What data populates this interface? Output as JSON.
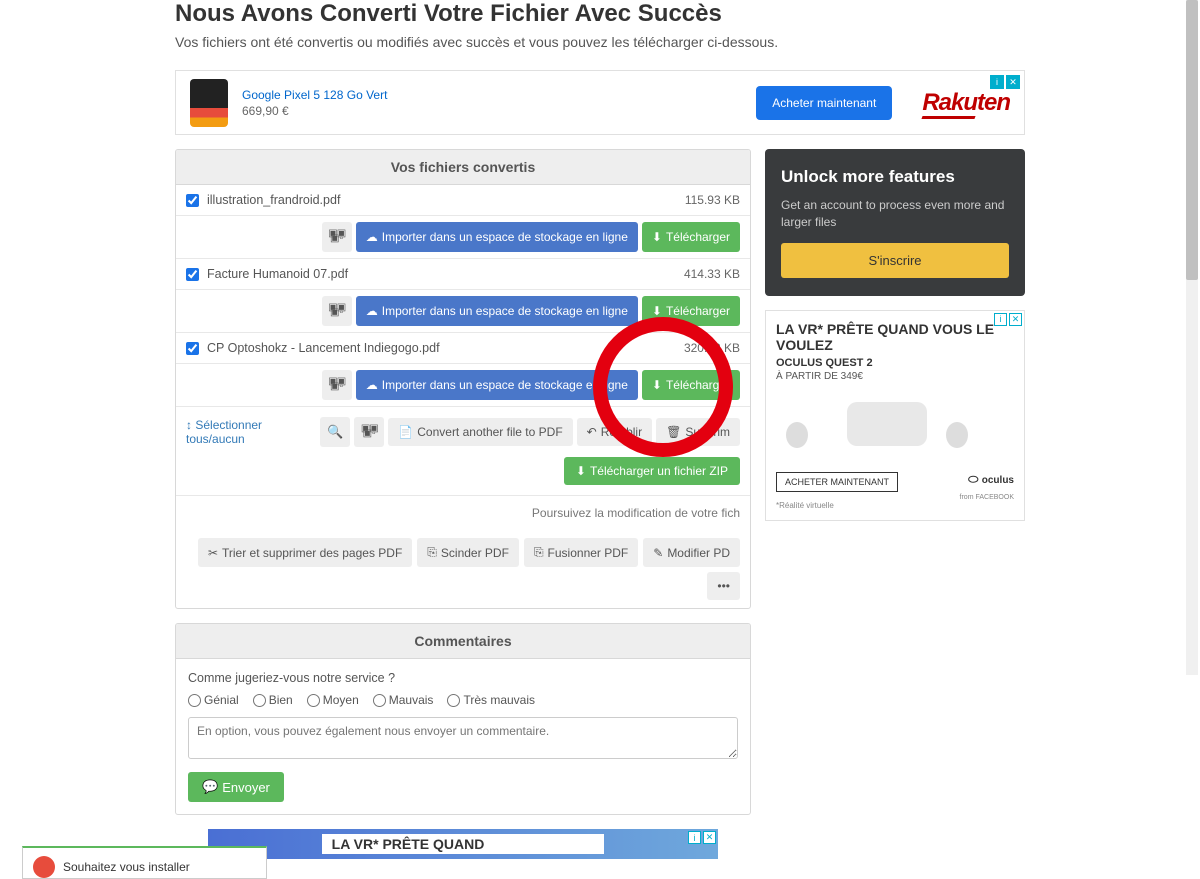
{
  "header": {
    "title": "Nous Avons Converti Votre Fichier Avec Succès",
    "subtitle": "Vos fichiers ont été convertis ou modifiés avec succès et vous pouvez les télécharger ci-dessous."
  },
  "ad_top": {
    "product": "Google Pixel 5 128 Go Vert",
    "price": "669,90 €",
    "buy": "Acheter maintenant",
    "brand": "Rakuten"
  },
  "files_panel": {
    "header": "Vos fichiers convertis",
    "files": [
      {
        "name": "illustration_frandroid.pdf",
        "size": "115.93 KB",
        "checked": true
      },
      {
        "name": "Facture Humanoid 07.pdf",
        "size": "414.33 KB",
        "checked": true
      },
      {
        "name": "CP Optoshokz - Lancement Indiegogo.pdf",
        "size": "320.92 KB",
        "checked": true
      }
    ],
    "import_label": "Importer dans un espace de stockage en ligne",
    "download_label": "Télécharger",
    "select_all": "Sélectionner tous/aucun",
    "convert_another": "Convert another file to PDF",
    "restore": "Rétablir",
    "delete": "Supprim",
    "zip": "Télécharger un fichier ZIP",
    "continue_text": "Poursuivez la modification de votre fich",
    "sort_pages": "Trier et supprimer des pages PDF",
    "split": "Scinder PDF",
    "merge": "Fusionner PDF",
    "modify": "Modifier PD",
    "more": "•••"
  },
  "unlock": {
    "title": "Unlock more features",
    "desc": "Get an account to process even more and larger files",
    "button": "S'inscrire"
  },
  "side_ad": {
    "line1": "LA VR* PRÊTE QUAND VOUS LE VOULEZ",
    "line2": "OCULUS QUEST 2",
    "line3": "À PARTIR DE 349€",
    "buy": "ACHETER MAINTENANT",
    "note": "*Réalité virtuelle",
    "brand": "oculus",
    "from": "from FACEBOOK"
  },
  "comments": {
    "header": "Commentaires",
    "question": "Comme jugeriez-vous notre service ?",
    "options": [
      "Génial",
      "Bien",
      "Moyen",
      "Mauvais",
      "Très mauvais"
    ],
    "placeholder": "En option, vous pouvez également nous envoyer un commentaire.",
    "send": "Envoyer"
  },
  "bottom_ad": {
    "text": "LA VR* PRÊTE QUAND"
  },
  "install": {
    "text": "Souhaitez vous installer"
  }
}
